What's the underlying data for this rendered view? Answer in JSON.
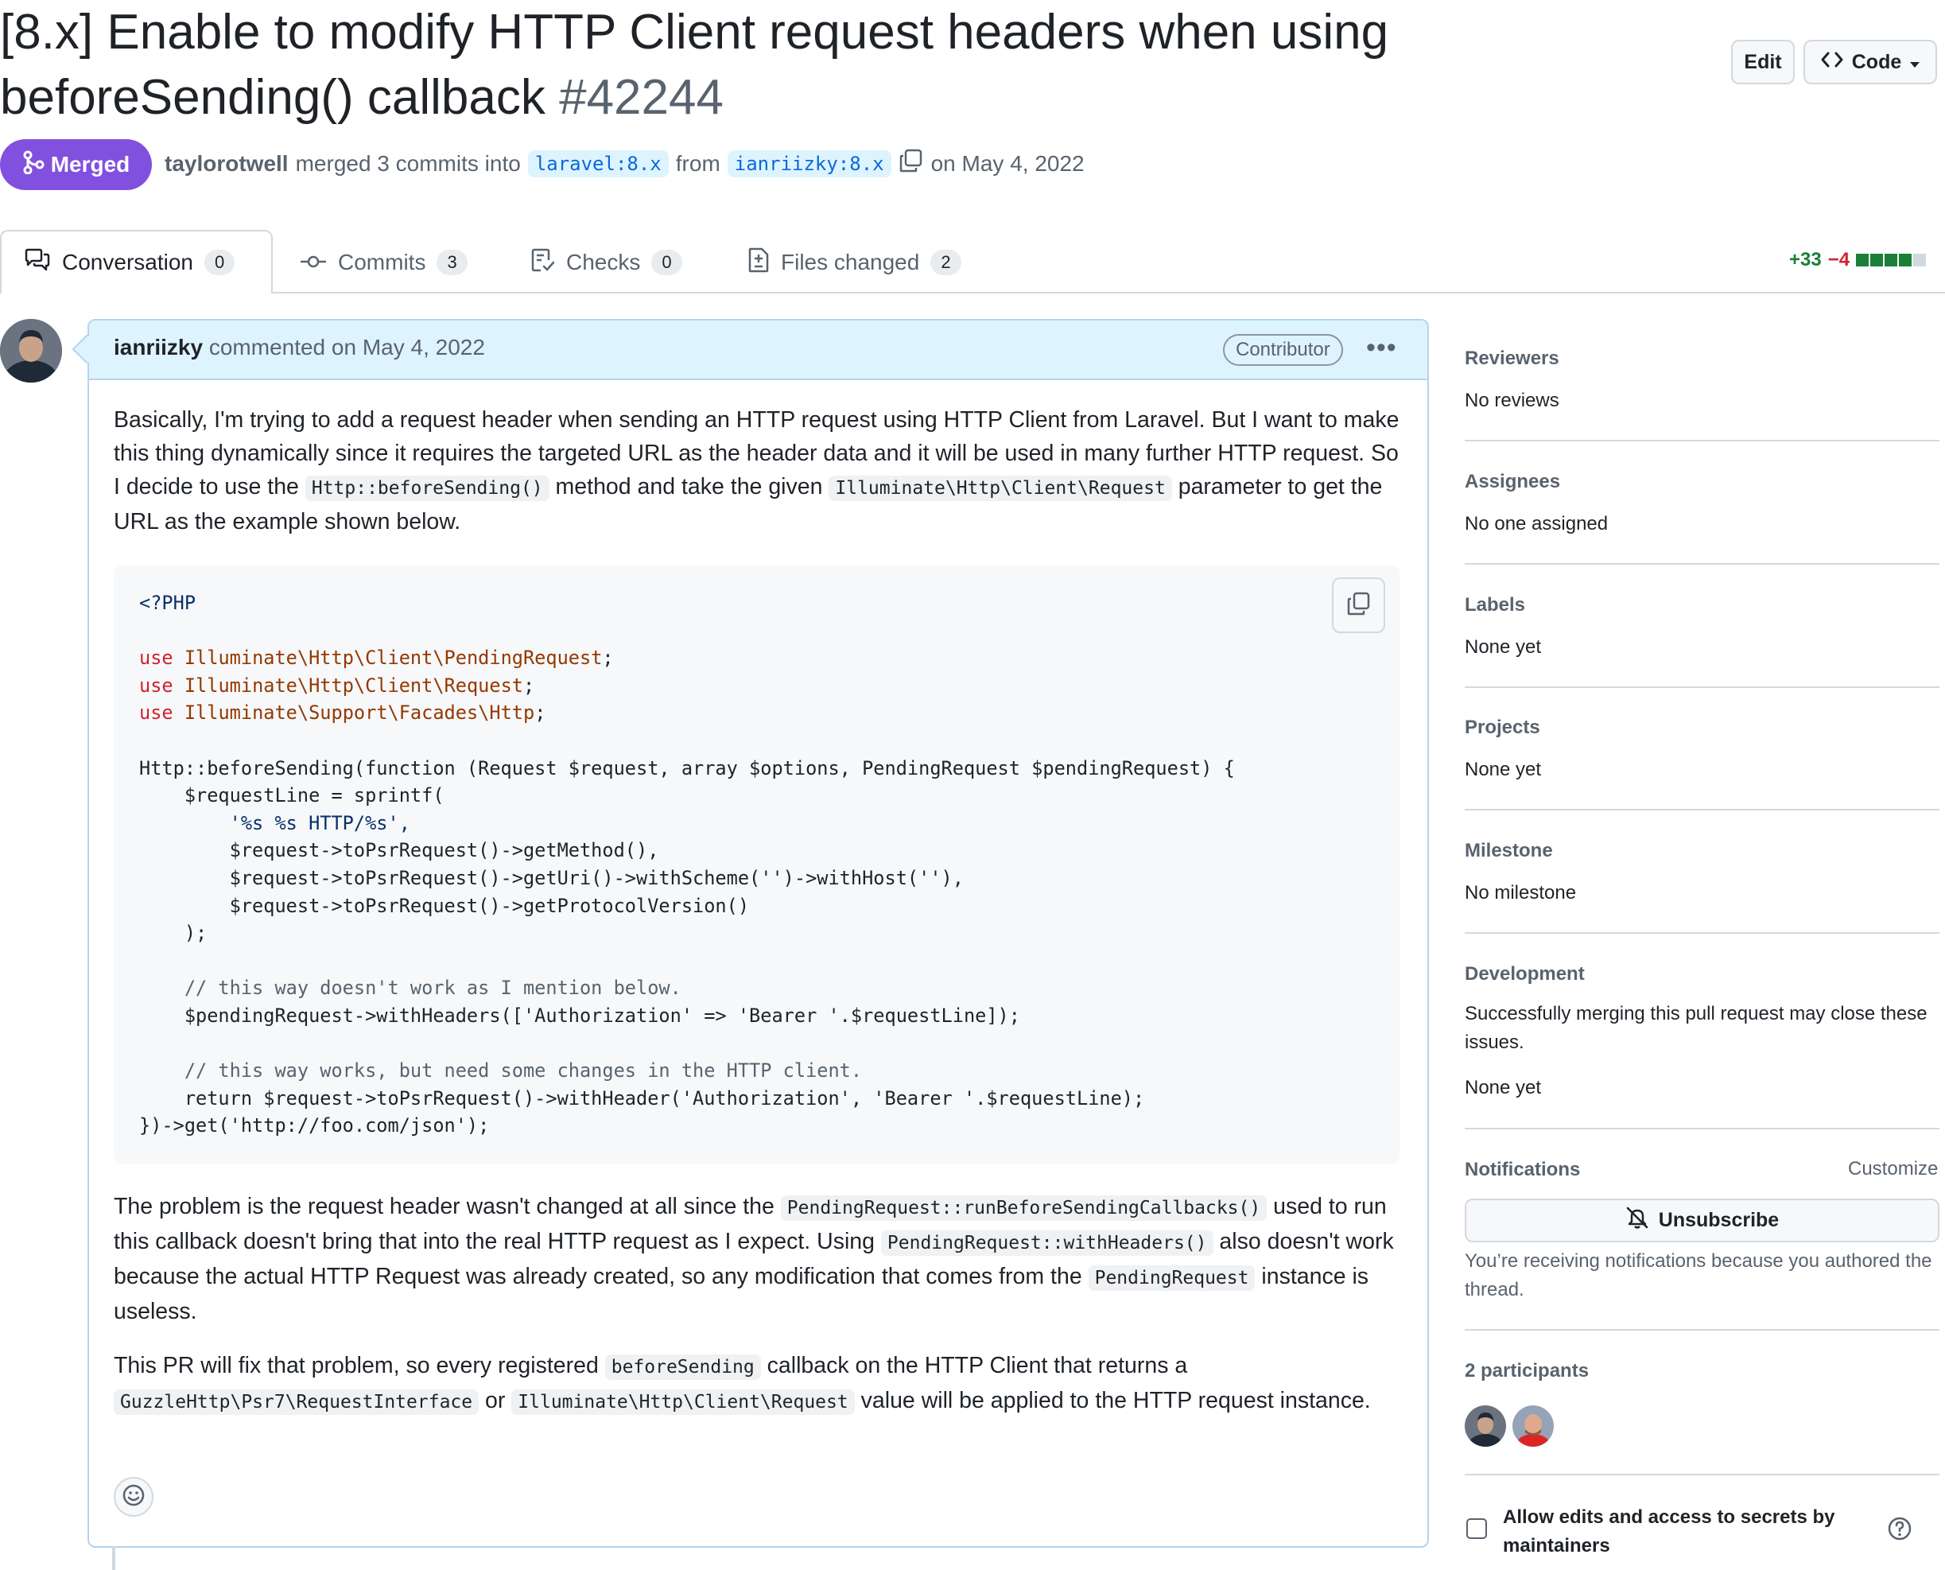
{
  "pr": {
    "title_line1": "[8.x] Enable to modify HTTP Client request headers when using",
    "title_line2": "beforeSending() callback",
    "number": "#42244",
    "edit_label": "Edit",
    "code_label": "Code",
    "state": "Merged",
    "merger": "taylorotwell",
    "merged_text": "merged 3 commits into",
    "base_branch": "laravel:8.x",
    "from_text": "from",
    "head_branch": "ianriizky:8.x",
    "date_text": "on May 4, 2022"
  },
  "tabs": [
    {
      "label": "Conversation",
      "count": "0"
    },
    {
      "label": "Commits",
      "count": "3"
    },
    {
      "label": "Checks",
      "count": "0"
    },
    {
      "label": "Files changed",
      "count": "2"
    }
  ],
  "diffstat": {
    "additions": "+33",
    "deletions": "−4"
  },
  "comment": {
    "author": "ianriizky",
    "meta": "commented on May 4, 2022",
    "badge": "Contributor",
    "p1_a": "Basically, I'm trying to add a request header when sending an HTTP request using HTTP Client from Laravel. But I want to make this thing dynamically since it requires the targeted URL as the header data and it will be used in many further HTTP request. So I decide to use the ",
    "p1_code1": "Http::beforeSending()",
    "p1_b": " method and take the given ",
    "p1_code2": "Illuminate\\Http\\Client\\Request",
    "p1_c": " parameter to get the URL as the example shown below.",
    "code": {
      "l01": "<?PHP",
      "l03_kw": "use",
      "l03_ns": "Illuminate\\Http\\Client\\PendingRequest",
      "l04_kw": "use",
      "l04_ns": "Illuminate\\Http\\Client\\Request",
      "l05_kw": "use",
      "l05_ns": "Illuminate\\Support\\Facades\\Http",
      "l07": "Http::beforeSending(function (Request $request, array $options, PendingRequest $pendingRequest) {",
      "l08": "    $requestLine = sprintf(",
      "l09": "        '%s %s HTTP/%s',",
      "l10": "        $request->toPsrRequest()->getMethod(),",
      "l11": "        $request->toPsrRequest()->getUri()->withScheme('')->withHost(''),",
      "l12": "        $request->toPsrRequest()->getProtocolVersion()",
      "l13": "    );",
      "l15": "    // this way doesn't work as I mention below.",
      "l16": "    $pendingRequest->withHeaders(['Authorization' => 'Bearer '.$requestLine]);",
      "l18": "    // this way works, but need some changes in the HTTP client.",
      "l19": "    return $request->toPsrRequest()->withHeader('Authorization', 'Bearer '.$requestLine);",
      "l20": "})->get('http://foo.com/json');"
    },
    "p2_a": "The problem is the request header wasn't changed at all since the ",
    "p2_code1": "PendingRequest::runBeforeSendingCallbacks()",
    "p2_b": " used to run this callback doesn't bring that into the real HTTP request as I expect. Using ",
    "p2_code2": "PendingRequest::withHeaders()",
    "p2_c": " also doesn't work because the actual HTTP Request was already created, so any modification that comes from the ",
    "p2_code3": "PendingRequest",
    "p2_d": " instance is useless.",
    "p3_a": "This PR will fix that problem, so every registered ",
    "p3_code1": "beforeSending",
    "p3_b": " callback on the HTTP Client that returns a ",
    "p3_code2": "GuzzleHttp\\Psr7\\RequestInterface",
    "p3_c": " or ",
    "p3_code3": "Illuminate\\Http\\Client\\Request",
    "p3_d": " value will be applied to the HTTP request instance."
  },
  "sidebar": {
    "reviewers_title": "Reviewers",
    "reviewers_value": "No reviews",
    "assignees_title": "Assignees",
    "assignees_value": "No one assigned",
    "labels_title": "Labels",
    "labels_value": "None yet",
    "projects_title": "Projects",
    "projects_value": "None yet",
    "milestone_title": "Milestone",
    "milestone_value": "No milestone",
    "development_title": "Development",
    "development_text": "Successfully merging this pull request may close these issues.",
    "development_value": "None yet",
    "notifications_title": "Notifications",
    "customize_label": "Customize",
    "unsubscribe_label": "Unsubscribe",
    "notifications_text": "You’re receiving notifications because you authored the thread.",
    "participants_title": "2 participants",
    "allow_edits_label": "Allow edits and access to secrets by maintainers"
  },
  "colors": {
    "merged": "#8250df",
    "link": "#0969da",
    "add": "#1a7f37",
    "del": "#cf222e"
  },
  "icons": [
    "git-merge-icon",
    "copy-icon",
    "comment-discussion-icon",
    "git-commit-icon",
    "checklist-icon",
    "file-diff-icon",
    "kebab-horizontal-icon",
    "smiley-icon",
    "bell-slash-icon",
    "question-icon",
    "triangle-down-icon",
    "code-icon"
  ]
}
